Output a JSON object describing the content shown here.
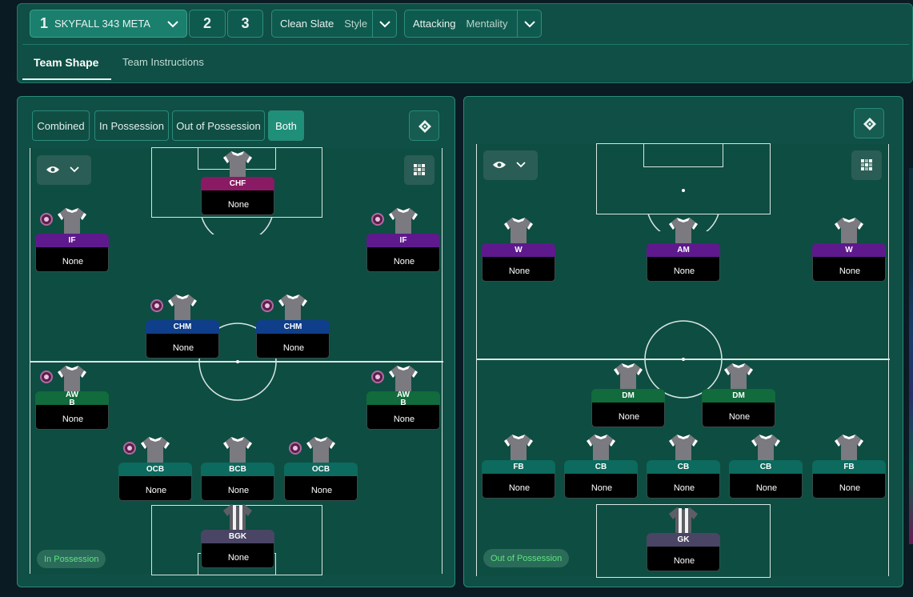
{
  "header": {
    "tactic_main": {
      "number": "1",
      "name": "SKYFALL 343 META"
    },
    "tactic_slots": [
      "2",
      "3"
    ],
    "style": {
      "value": "Clean Slate",
      "label": "Style"
    },
    "mentality": {
      "value": "Attacking",
      "label": "Mentality"
    }
  },
  "tabs": [
    {
      "label": "Team Shape",
      "active": true
    },
    {
      "label": "Team Instructions",
      "active": false
    }
  ],
  "left_panel": {
    "segments": [
      {
        "label": "Combined",
        "active": false
      },
      {
        "label": "In Possession",
        "active": false
      },
      {
        "label": "Out of Possession",
        "active": false
      },
      {
        "label": "Both",
        "active": true
      }
    ],
    "phase_label": "In Possession",
    "players": [
      {
        "role": "CHF",
        "name": "None",
        "duty": false
      },
      {
        "role": "IF",
        "name": "None",
        "duty": true
      },
      {
        "role": "IF",
        "name": "None",
        "duty": true
      },
      {
        "role": "CHM",
        "name": "None",
        "duty": true
      },
      {
        "role": "CHM",
        "name": "None",
        "duty": true
      },
      {
        "role": "AW\nB",
        "name": "None",
        "duty": true
      },
      {
        "role": "AW\nB",
        "name": "None",
        "duty": true
      },
      {
        "role": "OCB",
        "name": "None",
        "duty": true
      },
      {
        "role": "BCB",
        "name": "None",
        "duty": false
      },
      {
        "role": "OCB",
        "name": "None",
        "duty": true
      },
      {
        "role": "BGK",
        "name": "None",
        "duty": false
      }
    ]
  },
  "right_panel": {
    "phase_label": "Out of Possession",
    "players": [
      {
        "role": "W",
        "name": "None"
      },
      {
        "role": "AM",
        "name": "None"
      },
      {
        "role": "W",
        "name": "None"
      },
      {
        "role": "DM",
        "name": "None"
      },
      {
        "role": "DM",
        "name": "None"
      },
      {
        "role": "FB",
        "name": "None"
      },
      {
        "role": "CB",
        "name": "None"
      },
      {
        "role": "CB",
        "name": "None"
      },
      {
        "role": "CB",
        "name": "None"
      },
      {
        "role": "FB",
        "name": "None"
      },
      {
        "role": "GK",
        "name": "None"
      }
    ]
  },
  "colors": {
    "panel_bg": "#0f4f45",
    "pitch_bg": "#0e4d42",
    "accent": "#1f8f7a",
    "phase_text": "#5de37f"
  },
  "icons": [
    "chevron-down-icon",
    "pitch-swap-icon",
    "eye-icon",
    "grid-icon",
    "shirt-icon",
    "duty-icon"
  ]
}
